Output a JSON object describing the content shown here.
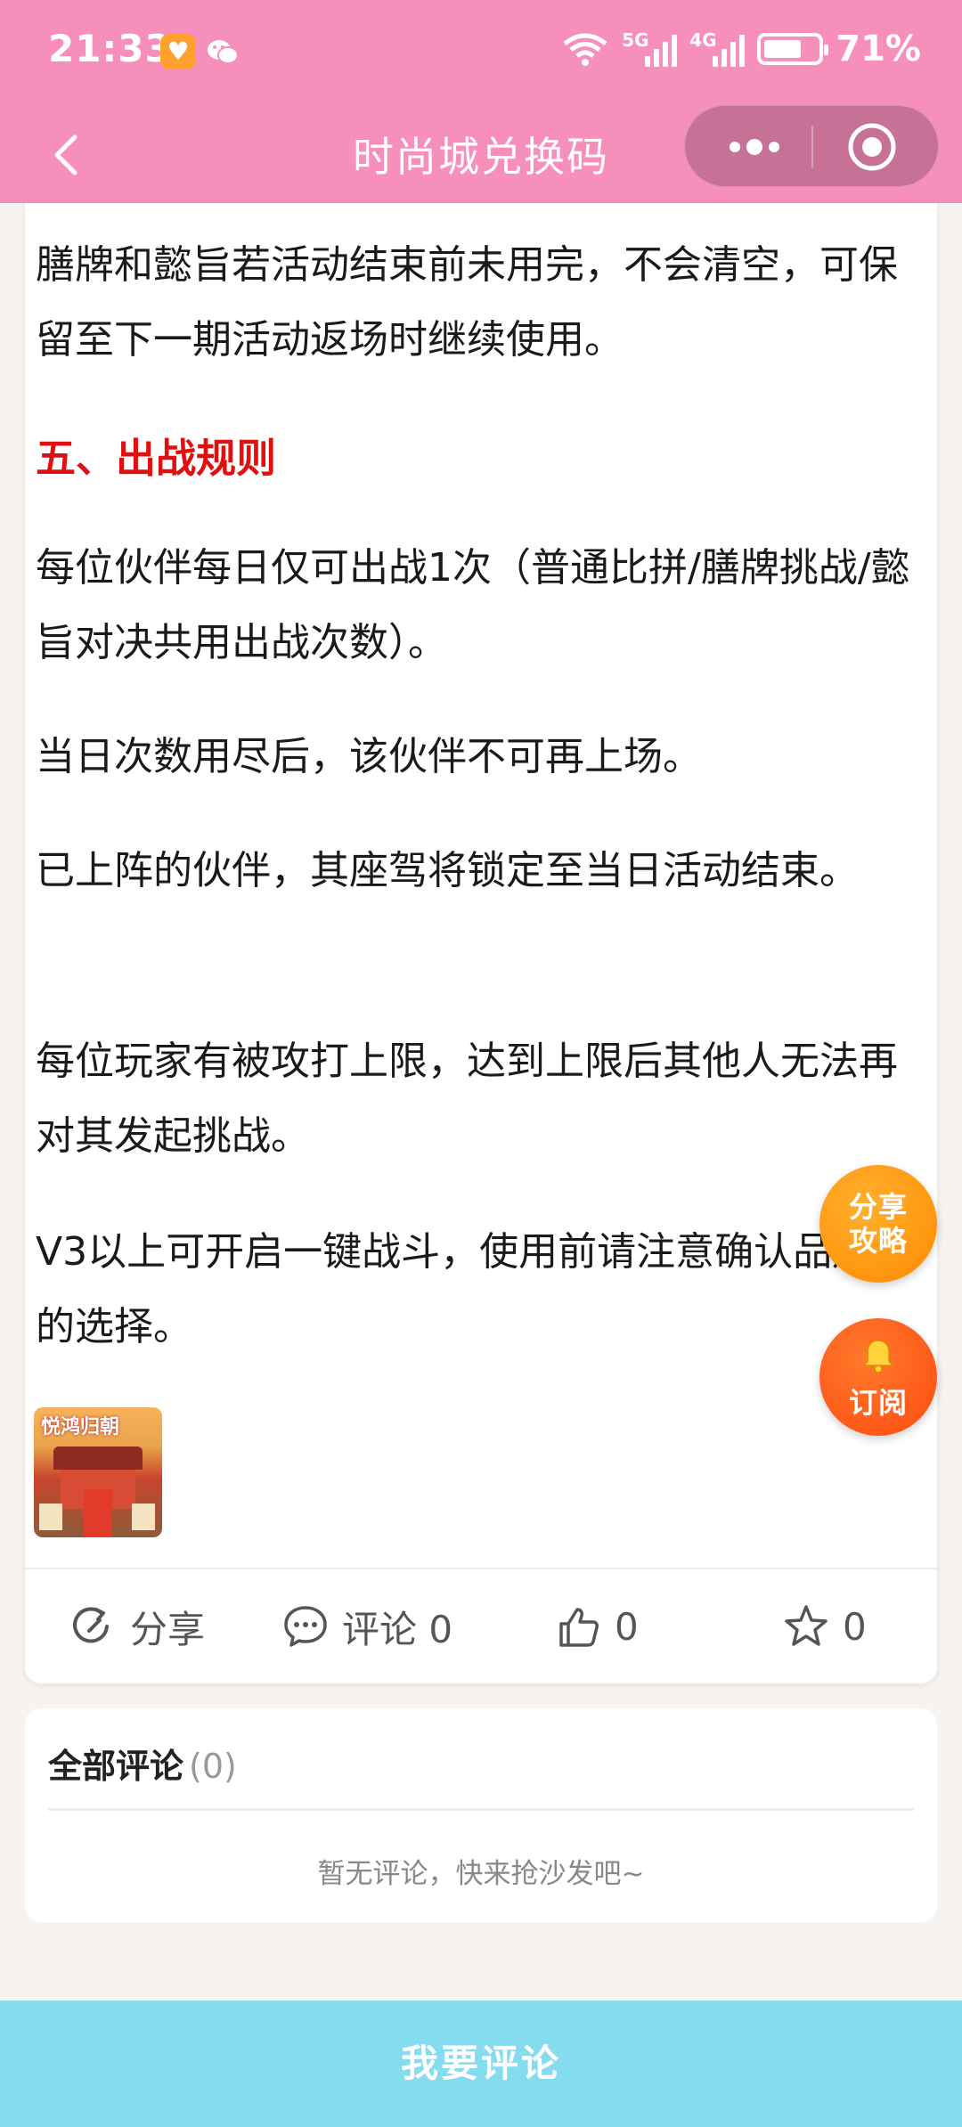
{
  "status_bar": {
    "time": "21:33",
    "battery": "71%",
    "battery_level": 0.71,
    "net_5g": "5G",
    "net_4g": "4G",
    "net_wifi": "6"
  },
  "nav": {
    "title": "时尚城兑换码"
  },
  "article": {
    "p_tail": "膳牌和懿旨若活动结束前未用完，不会清空，可保留至下一期活动返场时继续使用。",
    "section_heading": "五、出战规则",
    "rule1": "每位伙伴每日仅可出战1次（普通比拼/膳牌挑战/懿旨对决共用出战次数）。",
    "rule2": "当日次数用尽后，该伙伴不可再上场。",
    "rule3": "已上阵的伙伴，其座驾将锁定至当日活动结束。",
    "rule4": "每位玩家有被攻打上限，达到上限后其他人无法再对其发起挑战。",
    "rule5": "V3以上可开启一键战斗，使用前请注意确认品加成的选择。",
    "thumb_text": "悦鸿归朝"
  },
  "actions": {
    "share": "分享",
    "comment": "评论 0",
    "like": "0",
    "favorite": "0"
  },
  "comments": {
    "title": "全部评论",
    "count": "(0)",
    "empty": "暂无评论，快来抢沙发吧~"
  },
  "floating": {
    "share_guide": "分享攻略",
    "subscribe": "订阅"
  },
  "bottom": {
    "button": "我要评论"
  },
  "colors": {
    "header": "#f78fbd",
    "heading_red": "#e01010",
    "bottom_bar": "#85dcef",
    "float_orange": "#ff8a00"
  }
}
